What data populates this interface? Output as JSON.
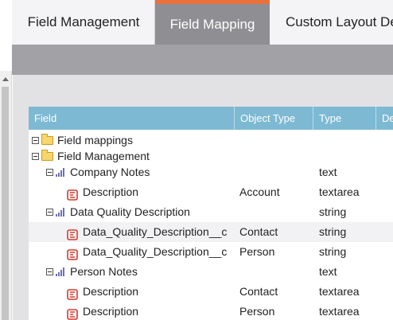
{
  "tabs": [
    {
      "label": "Field Management"
    },
    {
      "label": "Field Mapping"
    },
    {
      "label": "Custom Layout De"
    }
  ],
  "grid": {
    "columns": [
      "Field",
      "Object Type",
      "Type",
      "De"
    ],
    "rows": [
      {
        "kind": "group",
        "field": "Field mappings",
        "object": "",
        "type": ""
      },
      {
        "kind": "group",
        "field": "Field Management",
        "object": "",
        "type": ""
      },
      {
        "kind": "object",
        "field": "Company Notes",
        "object": "",
        "type": "text"
      },
      {
        "kind": "field",
        "field": "Description",
        "object": "Account",
        "type": "textarea"
      },
      {
        "kind": "object",
        "field": "Data Quality Description",
        "object": "",
        "type": "string"
      },
      {
        "kind": "field",
        "field": "Data_Quality_Description__c",
        "object": "Contact",
        "type": "string"
      },
      {
        "kind": "field",
        "field": "Data_Quality_Description__c",
        "object": "Person",
        "type": "string"
      },
      {
        "kind": "object",
        "field": "Person Notes",
        "object": "",
        "type": "text"
      },
      {
        "kind": "field",
        "field": "Description",
        "object": "Contact",
        "type": "textarea"
      },
      {
        "kind": "field",
        "field": "Description",
        "object": "Person",
        "type": "textarea"
      }
    ]
  },
  "colors": {
    "accent": "#e9713d",
    "header": "#7eb9d3",
    "active_tab": "#8f8f93"
  },
  "icons": {
    "group": "folder-icon",
    "object": "bar-chart-icon",
    "field": "field-mapping-icon"
  }
}
